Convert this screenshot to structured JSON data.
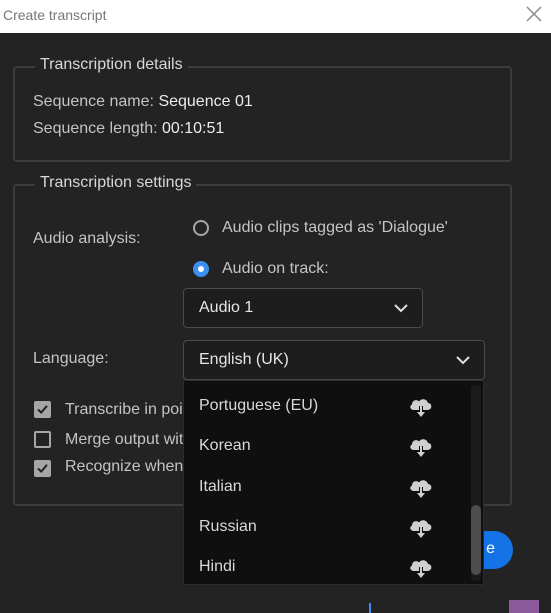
{
  "window": {
    "title": "Create transcript",
    "close_icon": "close-icon"
  },
  "details": {
    "legend": "Transcription details",
    "sequence_name_label": "Sequence name:",
    "sequence_name_value": "Sequence 01",
    "sequence_length_label": "Sequence length:",
    "sequence_length_value": "00:10:51"
  },
  "settings": {
    "legend": "Transcription settings",
    "audio_analysis_label": "Audio analysis:",
    "radio_dialogue_label": "Audio clips tagged as 'Dialogue'",
    "radio_dialogue_selected": false,
    "radio_track_label": "Audio on track:",
    "radio_track_selected": true,
    "track_select_value": "Audio 1",
    "language_label": "Language:",
    "language_select_value": "English (UK)",
    "checkboxes": [
      {
        "label": "Transcribe in poir",
        "checked": true
      },
      {
        "label": "Merge output wit",
        "checked": false
      },
      {
        "label": "Recognize when",
        "checked": true
      }
    ]
  },
  "language_dropdown": {
    "options": [
      {
        "label": "Portuguese (EU)",
        "icon": "cloud-download-icon"
      },
      {
        "label": "Korean",
        "icon": "cloud-download-icon"
      },
      {
        "label": "Italian",
        "icon": "cloud-download-icon"
      },
      {
        "label": "Russian",
        "icon": "cloud-download-icon"
      },
      {
        "label": "Hindi",
        "icon": "cloud-download-icon"
      }
    ]
  },
  "primary_button": {
    "visible_label": "e"
  },
  "colors": {
    "accent": "#1473e6",
    "radio_on": "#3b8fef",
    "background": "#232323"
  }
}
